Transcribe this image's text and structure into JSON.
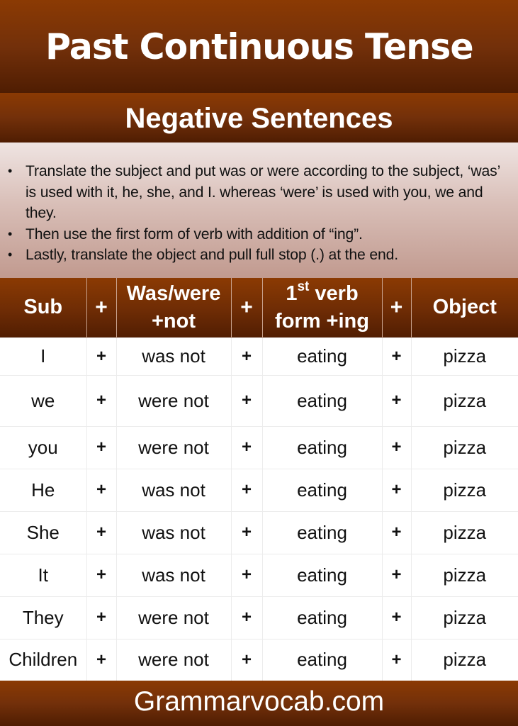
{
  "header": {
    "title": "Past Continuous Tense",
    "subtitle": "Negative Sentences"
  },
  "instructions": {
    "bullet_icon": "•",
    "items": [
      "Translate the subject and put was or were according to the subject, ‘was’ is used with it, he, she, and I. whereas ‘were’ is used with you, we and they.",
      "Then use the first form of verb with addition of “ing”.",
      "Lastly, translate the object and pull full stop (.) at the end."
    ]
  },
  "table": {
    "columns": {
      "sub": "Sub",
      "plus1": "+",
      "aux_line1": "Was/were",
      "aux_line2": "+not",
      "plus2": "+",
      "verb_number": "1",
      "verb_sup": "st",
      "verb_line1_rest": " verb",
      "verb_line2": "form +ing",
      "plus3": "+",
      "object": "Object"
    },
    "rows": [
      {
        "sub": "I",
        "plus1": "+",
        "aux": "was not",
        "plus2": "+",
        "verb": "eating",
        "plus3": "+",
        "object": "pizza"
      },
      {
        "sub": "we",
        "plus1": "+",
        "aux": "were not",
        "plus2": "+",
        "verb": "eating",
        "plus3": "+",
        "object": "pizza"
      },
      {
        "sub": "you",
        "plus1": "+",
        "aux": "were not",
        "plus2": "+",
        "verb": "eating",
        "plus3": "+",
        "object": "pizza"
      },
      {
        "sub": "He",
        "plus1": "+",
        "aux": "was not",
        "plus2": "+",
        "verb": "eating",
        "plus3": "+",
        "object": "pizza"
      },
      {
        "sub": "She",
        "plus1": "+",
        "aux": "was not",
        "plus2": "+",
        "verb": "eating",
        "plus3": "+",
        "object": "pizza"
      },
      {
        "sub": "It",
        "plus1": "+",
        "aux": "was not",
        "plus2": "+",
        "verb": "eating",
        "plus3": "+",
        "object": "pizza"
      },
      {
        "sub": "They",
        "plus1": "+",
        "aux": "were not",
        "plus2": "+",
        "verb": "eating",
        "plus3": "+",
        "object": "pizza"
      },
      {
        "sub": "Children",
        "plus1": "+",
        "aux": "were not",
        "plus2": "+",
        "verb": "eating",
        "plus3": "+",
        "object": "pizza"
      }
    ]
  },
  "footer": {
    "site": "Grammarvocab.com"
  },
  "colors": {
    "band_top": "#8b3a03",
    "band_bottom": "#4f1d02",
    "instructions_bg_top": "#efe4e2",
    "instructions_bg_bottom": "#c19a8f",
    "text": "#111111",
    "header_text": "#ffffff"
  }
}
